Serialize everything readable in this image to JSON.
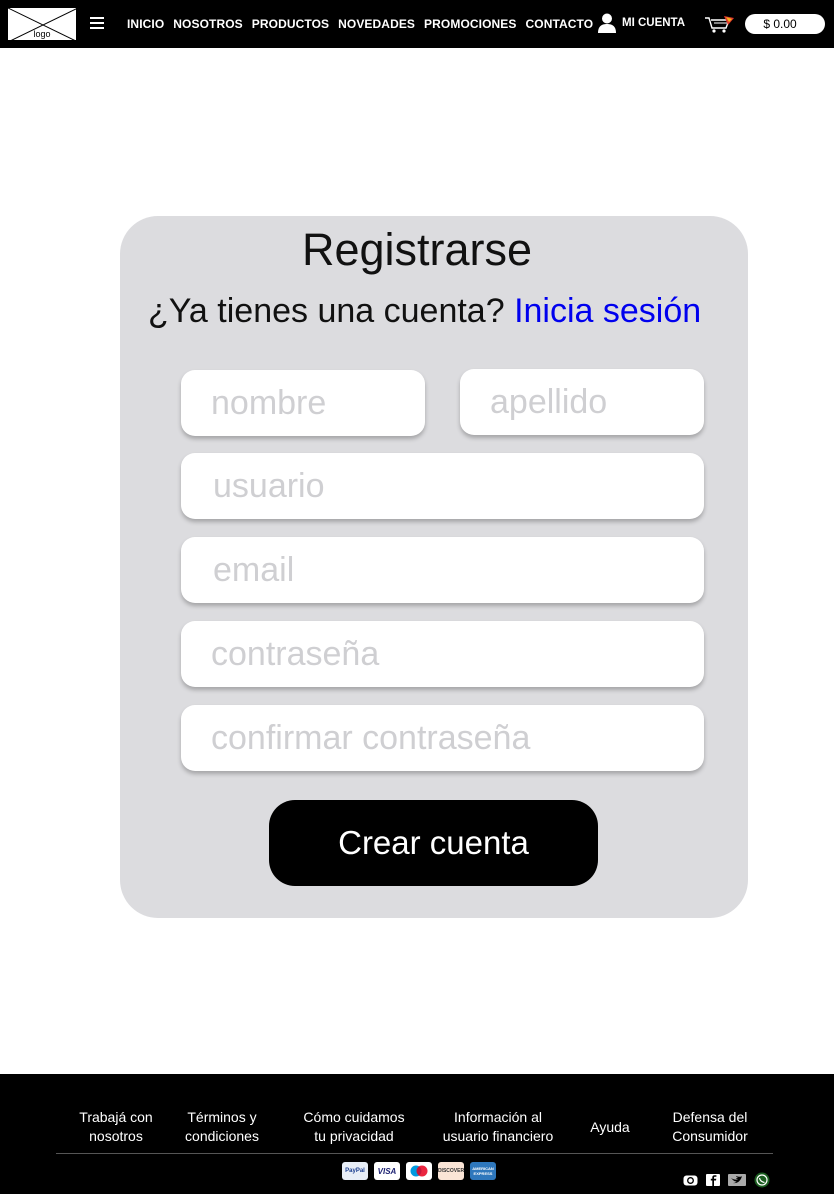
{
  "header": {
    "logo_text": "logo",
    "nav": [
      "INICIO",
      "NOSOTROS",
      "PRODUCTOS",
      "NOVEDADES",
      "PROMOCIONES",
      "CONTACTO"
    ],
    "account_label": "MI CUENTA",
    "balance": "$ 0.00"
  },
  "form": {
    "title": "Registrarse",
    "subtitle_prefix": "¿Ya tienes una cuenta?",
    "subtitle_link": "Inicia sesión",
    "fields": {
      "nombre": "nombre",
      "apellido": "apellido",
      "usuario": "usuario",
      "email": "email",
      "password": "contraseña",
      "confirm": "confirmar contraseña"
    },
    "submit": "Crear cuenta"
  },
  "footer": {
    "links": [
      [
        "Trabajá con",
        "nosotros"
      ],
      [
        "Términos y",
        "condiciones"
      ],
      [
        "Cómo cuidamos",
        "tu privacidad"
      ],
      [
        "Información al",
        "usuario financiero"
      ],
      [
        "Ayuda"
      ],
      [
        "Defensa del",
        "Consumidor"
      ]
    ],
    "payments": [
      {
        "name": "PayPal",
        "bg": "#e8eef7",
        "fg": "#1a3d8f"
      },
      {
        "name": "VISA",
        "bg": "#ffffff",
        "fg": "#1a1f71"
      },
      {
        "name": "maestro",
        "bg": "#ffffff",
        "fg": "#000000"
      },
      {
        "name": "DISCOVER",
        "bg": "#fbe5d6",
        "fg": "#333333"
      },
      {
        "name": "AMERICAN EXPRESS",
        "bg": "#2e77bc",
        "fg": "#ffffff"
      }
    ],
    "social_icons": [
      "instagram-icon",
      "facebook-icon",
      "twitter-icon",
      "whatsapp-icon"
    ]
  },
  "colors": {
    "header_bg": "#000000",
    "card_bg": "#dcdcdf",
    "link": "#0000ee",
    "placeholder": "#cfcfd2",
    "button_bg": "#000000"
  }
}
